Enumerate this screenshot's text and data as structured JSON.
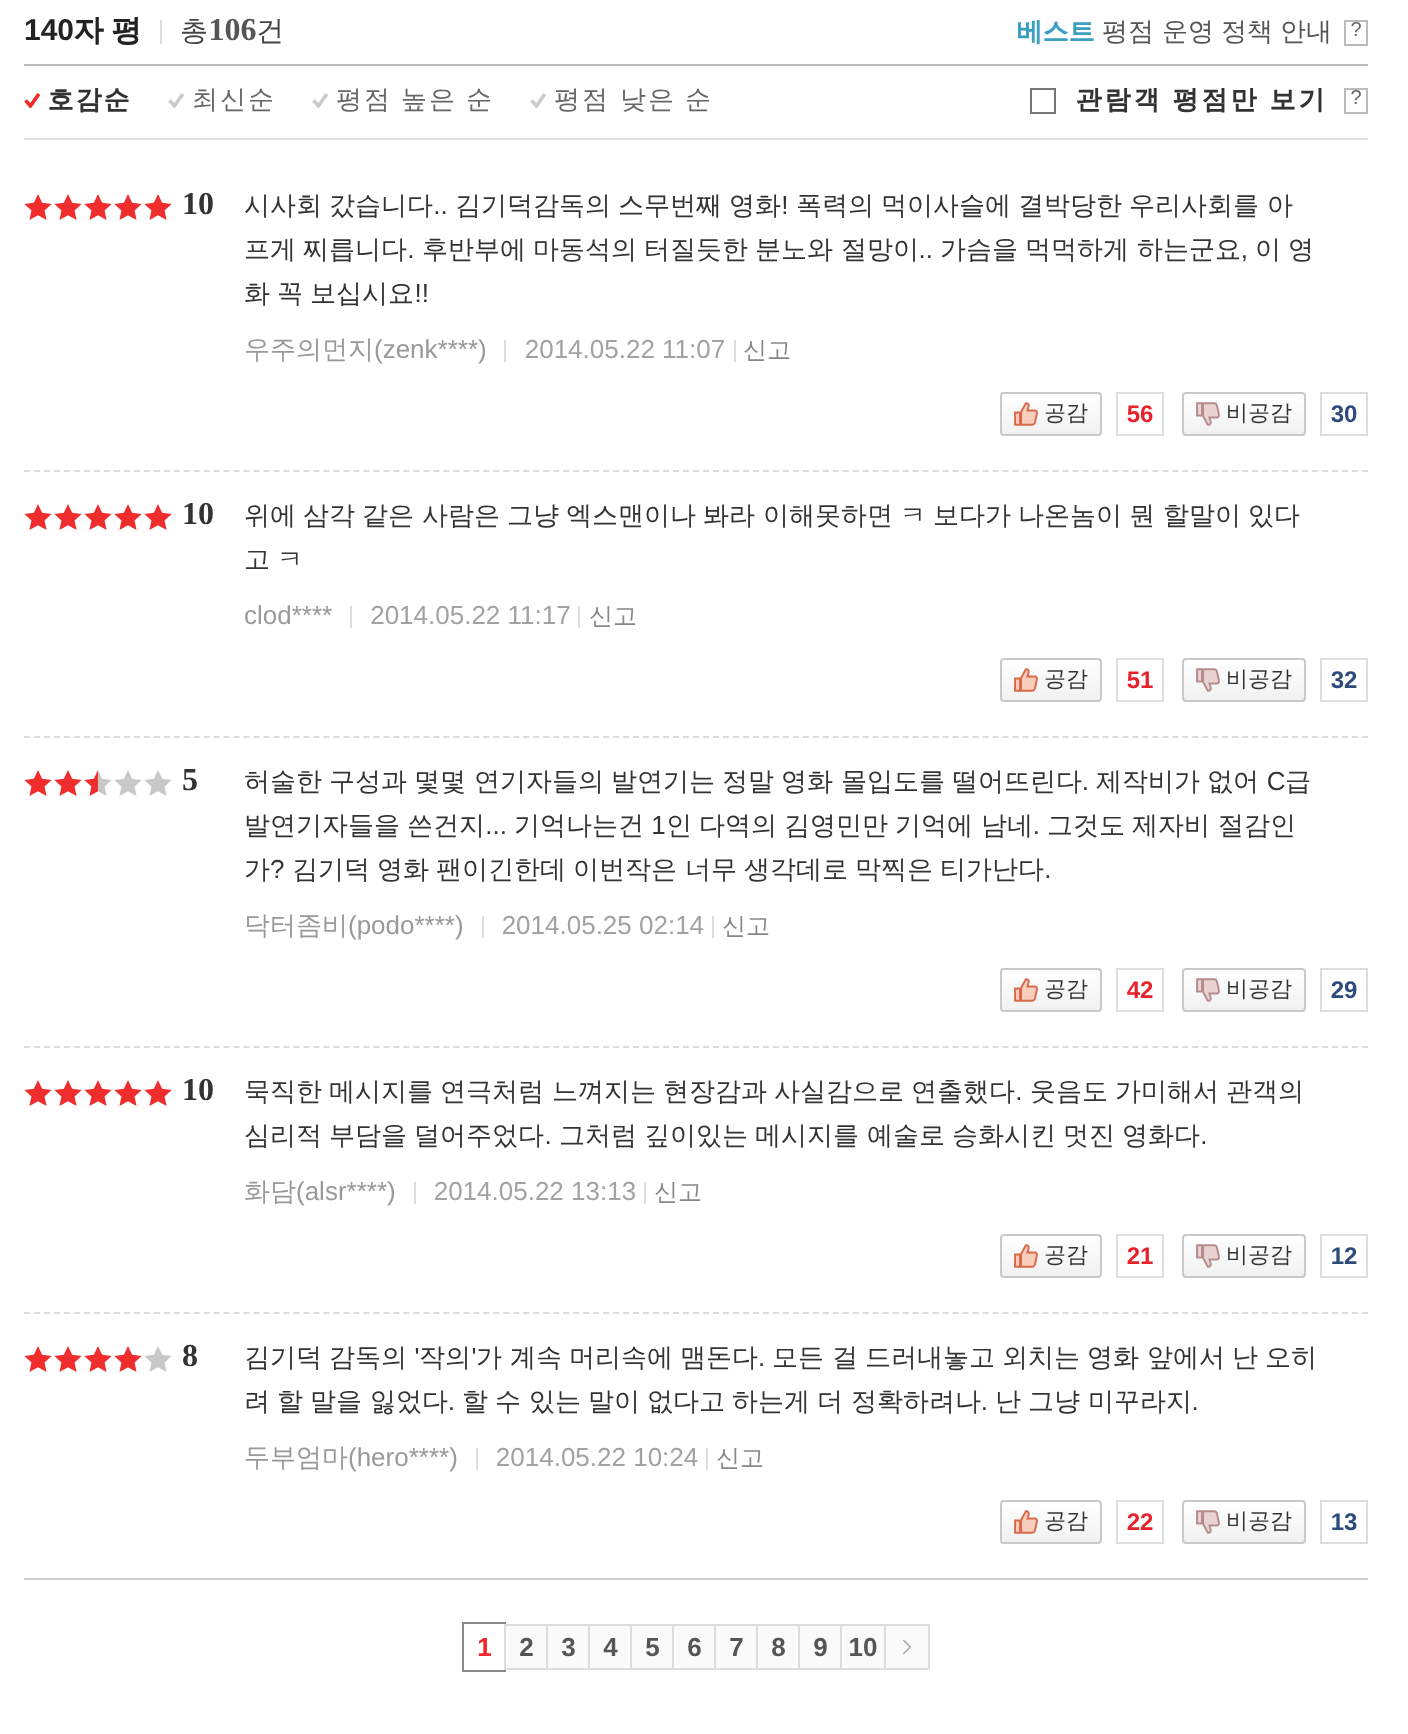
{
  "header": {
    "title": "140자 평",
    "total": "총**106**건",
    "policy": "**베스트** 평점 운영 정책 안내",
    "policy_help": "?"
  },
  "sort_options": [
    {
      "label": "호감순",
      "selected": true
    },
    {
      "label": "최신순",
      "selected": false
    },
    {
      "label": "평점 높은 순",
      "selected": false
    },
    {
      "label": "평점 낮은 순",
      "selected": false
    }
  ],
  "filter": {
    "label": "관람객 평점만 보기",
    "checked": false,
    "help": "?"
  },
  "reviews": [
    {
      "stars": 5,
      "score": "10",
      "text": "시사회 갔습니다.. 김기덕감독의 스무번째 영화! 폭력의 먹이사슬에 결박당한 우리사회를 아프게 찌릅니다. 후반부에 마동석의 터질듯한 분노와 절망이.. 가슴을 먹먹하게 하는군요, 이 영화 꼭 보십시요!!",
      "author": "우주의먼지(zenk****)",
      "date": "2014.05.22 11:07",
      "report": "신고",
      "like_label": "공감",
      "likes": "56",
      "dislike_label": "비공감",
      "dislikes": "30"
    },
    {
      "stars": 5,
      "score": "10",
      "text": "위에 삼각 같은 사람은 그냥 엑스맨이나 봐라 이해못하면 ㅋ 보다가 나온놈이 뭔 할말이 있다고 ㅋ",
      "author": "clod****",
      "date": "2014.05.22 11:17",
      "report": "신고",
      "like_label": "공감",
      "likes": "51",
      "dislike_label": "비공감",
      "dislikes": "32"
    },
    {
      "stars": 2.5,
      "score": "5",
      "text": "허술한 구성과 몇몇 연기자들의 발연기는 정말 영화 몰입도를 떨어뜨린다. 제작비가 없어 C급 발연기자들을 쓴건지... 기억나는건 1인 다역의 김영민만 기억에 남네. 그것도 제자비 절감인가? 김기덕 영화 팬이긴한데 이번작은 너무 생각데로 막찍은 티가난다.",
      "author": "닥터좀비(podo****)",
      "date": "2014.05.25 02:14",
      "report": "신고",
      "like_label": "공감",
      "likes": "42",
      "dislike_label": "비공감",
      "dislikes": "29"
    },
    {
      "stars": 5,
      "score": "10",
      "text": "묵직한 메시지를 연극처럼 느껴지는 현장감과 사실감으로 연출했다. 웃음도 가미해서 관객의 심리적 부담을 덜어주었다. 그처럼 깊이있는 메시지를 예술로 승화시킨 멋진 영화다.",
      "author": "화담(alsr****)",
      "date": "2014.05.22 13:13",
      "report": "신고",
      "like_label": "공감",
      "likes": "21",
      "dislike_label": "비공감",
      "dislikes": "12"
    },
    {
      "stars": 4,
      "score": "8",
      "text": "김기덕 감독의 '작의'가 계속 머리속에 맴돈다. 모든 걸 드러내놓고 외치는 영화 앞에서 난 오히려 할 말을 잃었다. 할 수 있는 말이 없다고 하는게 더 정확하려나. 난 그냥 미꾸라지.",
      "author": "두부엄마(hero****)",
      "date": "2014.05.22 10:24",
      "report": "신고",
      "like_label": "공감",
      "likes": "22",
      "dislike_label": "비공감",
      "dislikes": "13"
    }
  ],
  "pagination": {
    "pages": [
      {
        "label": "1",
        "selected": true
      },
      {
        "label": "2",
        "selected": false
      },
      {
        "label": "3",
        "selected": false
      },
      {
        "label": "4",
        "selected": false
      },
      {
        "label": "5",
        "selected": false
      },
      {
        "label": "6",
        "selected": false
      },
      {
        "label": "7",
        "selected": false
      },
      {
        "label": "8",
        "selected": false
      },
      {
        "label": "9",
        "selected": false
      },
      {
        "label": "10",
        "selected": false
      }
    ]
  }
}
